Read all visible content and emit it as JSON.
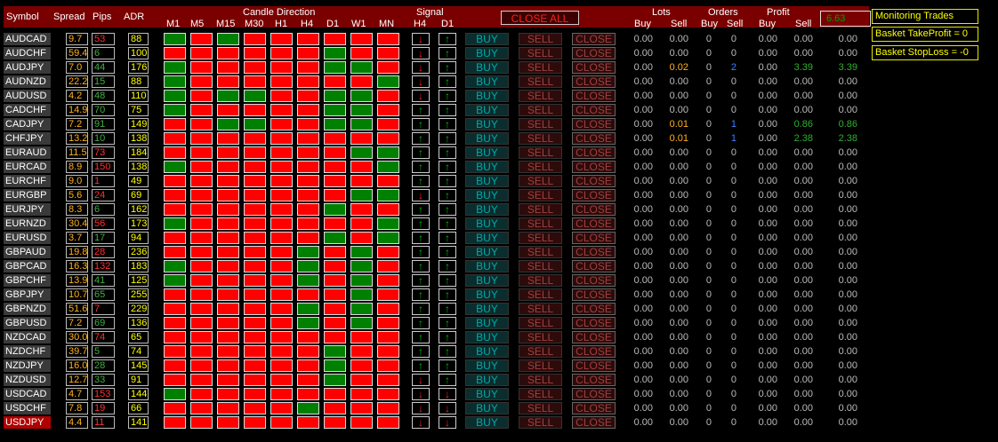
{
  "header": {
    "symbol": "Symbol",
    "spread": "Spread",
    "pips": "Pips",
    "adr": "ADR",
    "candle_direction": "Candle Direction",
    "timeframes": [
      "M1",
      "M5",
      "M15",
      "M30",
      "H1",
      "H4",
      "D1",
      "W1",
      "MN"
    ],
    "signal": "Signal",
    "signal_tfs": [
      "H4",
      "D1"
    ],
    "close_all": "CLOSE ALL",
    "lots": "Lots",
    "orders": "Orders",
    "profit": "Profit",
    "buy": "Buy",
    "sell": "Sell",
    "total_profit": "6.63"
  },
  "side_panel": {
    "monitoring": "Monitoring Trades",
    "basket_tp": "Basket TakeProfit = 0",
    "basket_sl": "Basket StopLoss = -0"
  },
  "buttons": {
    "buy": "BUY",
    "sell": "SELL",
    "close": "CLOSE"
  },
  "colors": {
    "red": "#ff0000",
    "green": "#008000",
    "header": "#7a0000",
    "selected_symbol": "#b00000"
  },
  "rows": [
    {
      "symbol": "AUDCAD",
      "spread": "9.7",
      "pips": "53",
      "pips_color": "#ff3030",
      "adr": "88",
      "candles": "GRGRRRRRR",
      "h4": "down",
      "d1": "up",
      "lots_buy": "0.00",
      "lots_sell": "0.00",
      "orders_buy": "0",
      "orders_sell": "0",
      "profit_buy": "0.00",
      "profit_sell": "0.00",
      "total": "0.00"
    },
    {
      "symbol": "AUDCHF",
      "spread": "59.4",
      "pips": "6",
      "pips_color": "#40b040",
      "adr": "100",
      "candles": "RRRRRRGRR",
      "h4": "down",
      "d1": "up",
      "lots_buy": "0.00",
      "lots_sell": "0.00",
      "orders_buy": "0",
      "orders_sell": "0",
      "profit_buy": "0.00",
      "profit_sell": "0.00",
      "total": "0.00"
    },
    {
      "symbol": "AUDJPY",
      "spread": "7.0",
      "pips": "44",
      "pips_color": "#40b040",
      "adr": "176",
      "candles": "GRRRRRGGR",
      "h4": "down",
      "d1": "up",
      "lots_buy": "0.00",
      "lots_sell": "0.02",
      "orders_buy": "0",
      "orders_sell": "2",
      "profit_buy": "0.00",
      "profit_sell": "3.39",
      "total": "3.39"
    },
    {
      "symbol": "AUDNZD",
      "spread": "22.2",
      "pips": "15",
      "pips_color": "#40b040",
      "adr": "88",
      "candles": "GRRRRRRRG",
      "h4": "down",
      "d1": "up",
      "lots_buy": "0.00",
      "lots_sell": "0.00",
      "orders_buy": "0",
      "orders_sell": "0",
      "profit_buy": "0.00",
      "profit_sell": "0.00",
      "total": "0.00"
    },
    {
      "symbol": "AUDUSD",
      "spread": "4.2",
      "pips": "48",
      "pips_color": "#40b040",
      "adr": "110",
      "candles": "GRGGRRGGR",
      "h4": "down",
      "d1": "up",
      "lots_buy": "0.00",
      "lots_sell": "0.00",
      "orders_buy": "0",
      "orders_sell": "0",
      "profit_buy": "0.00",
      "profit_sell": "0.00",
      "total": "0.00"
    },
    {
      "symbol": "CADCHF",
      "spread": "14.9",
      "pips": "70",
      "pips_color": "#40b040",
      "adr": "75",
      "candles": "GRRRRRGGR",
      "h4": "up",
      "d1": "up",
      "lots_buy": "0.00",
      "lots_sell": "0.00",
      "orders_buy": "0",
      "orders_sell": "0",
      "profit_buy": "0.00",
      "profit_sell": "0.00",
      "total": "0.00"
    },
    {
      "symbol": "CADJPY",
      "spread": "7.2",
      "pips": "91",
      "pips_color": "#40b040",
      "adr": "149",
      "candles": "RRGGRRGGR",
      "h4": "up",
      "d1": "up",
      "lots_buy": "0.00",
      "lots_sell": "0.01",
      "orders_buy": "0",
      "orders_sell": "1",
      "profit_buy": "0.00",
      "profit_sell": "0.86",
      "total": "0.86"
    },
    {
      "symbol": "CHFJPY",
      "spread": "13.2",
      "pips": "10",
      "pips_color": "#40b040",
      "adr": "138",
      "candles": "RRRRRRRRR",
      "h4": "up",
      "d1": "up",
      "lots_buy": "0.00",
      "lots_sell": "0.01",
      "orders_buy": "0",
      "orders_sell": "1",
      "profit_buy": "0.00",
      "profit_sell": "2.38",
      "total": "2.38"
    },
    {
      "symbol": "EURAUD",
      "spread": "11.5",
      "pips": "73",
      "pips_color": "#ff3030",
      "adr": "184",
      "candles": "RRRRRRRGG",
      "h4": "up",
      "d1": "up",
      "lots_buy": "0.00",
      "lots_sell": "0.00",
      "orders_buy": "0",
      "orders_sell": "0",
      "profit_buy": "0.00",
      "profit_sell": "0.00",
      "total": "0.00"
    },
    {
      "symbol": "EURCAD",
      "spread": "8.9",
      "pips": "150",
      "pips_color": "#ff3030",
      "adr": "138",
      "candles": "GRRRRRRRG",
      "h4": "up",
      "d1": "up",
      "lots_buy": "0.00",
      "lots_sell": "0.00",
      "orders_buy": "0",
      "orders_sell": "0",
      "profit_buy": "0.00",
      "profit_sell": "0.00",
      "total": "0.00"
    },
    {
      "symbol": "EURCHF",
      "spread": "9.0",
      "pips": "1",
      "pips_color": "#ff3030",
      "adr": "49",
      "candles": "RRRRRRRRR",
      "h4": "up",
      "d1": "up",
      "lots_buy": "0.00",
      "lots_sell": "0.00",
      "orders_buy": "0",
      "orders_sell": "0",
      "profit_buy": "0.00",
      "profit_sell": "0.00",
      "total": "0.00"
    },
    {
      "symbol": "EURGBP",
      "spread": "5.6",
      "pips": "24",
      "pips_color": "#ff3030",
      "adr": "69",
      "candles": "RRRRRRRGG",
      "h4": "down",
      "d1": "up",
      "lots_buy": "0.00",
      "lots_sell": "0.00",
      "orders_buy": "0",
      "orders_sell": "0",
      "profit_buy": "0.00",
      "profit_sell": "0.00",
      "total": "0.00"
    },
    {
      "symbol": "EURJPY",
      "spread": "8.3",
      "pips": "6",
      "pips_color": "#40b040",
      "adr": "162",
      "candles": "RRRRRRGRR",
      "h4": "up",
      "d1": "up",
      "lots_buy": "0.00",
      "lots_sell": "0.00",
      "orders_buy": "0",
      "orders_sell": "0",
      "profit_buy": "0.00",
      "profit_sell": "0.00",
      "total": "0.00"
    },
    {
      "symbol": "EURNZD",
      "spread": "30.4",
      "pips": "56",
      "pips_color": "#ff3030",
      "adr": "173",
      "candles": "GRRRRRRRG",
      "h4": "up",
      "d1": "up",
      "lots_buy": "0.00",
      "lots_sell": "0.00",
      "orders_buy": "0",
      "orders_sell": "0",
      "profit_buy": "0.00",
      "profit_sell": "0.00",
      "total": "0.00"
    },
    {
      "symbol": "EURUSD",
      "spread": "3.7",
      "pips": "17",
      "pips_color": "#40b040",
      "adr": "94",
      "candles": "RRRRRRGRG",
      "h4": "up",
      "d1": "up",
      "lots_buy": "0.00",
      "lots_sell": "0.00",
      "orders_buy": "0",
      "orders_sell": "0",
      "profit_buy": "0.00",
      "profit_sell": "0.00",
      "total": "0.00"
    },
    {
      "symbol": "GBPAUD",
      "spread": "19.8",
      "pips": "28",
      "pips_color": "#ff3030",
      "adr": "236",
      "candles": "RRRRRGRGR",
      "h4": "up",
      "d1": "up",
      "lots_buy": "0.00",
      "lots_sell": "0.00",
      "orders_buy": "0",
      "orders_sell": "0",
      "profit_buy": "0.00",
      "profit_sell": "0.00",
      "total": "0.00"
    },
    {
      "symbol": "GBPCAD",
      "spread": "16.3",
      "pips": "132",
      "pips_color": "#ff3030",
      "adr": "183",
      "candles": "GRRRRGRGR",
      "h4": "up",
      "d1": "up",
      "lots_buy": "0.00",
      "lots_sell": "0.00",
      "orders_buy": "0",
      "orders_sell": "0",
      "profit_buy": "0.00",
      "profit_sell": "0.00",
      "total": "0.00"
    },
    {
      "symbol": "GBPCHF",
      "spread": "13.9",
      "pips": "41",
      "pips_color": "#40b040",
      "adr": "125",
      "candles": "GRRRRGRGR",
      "h4": "up",
      "d1": "up",
      "lots_buy": "0.00",
      "lots_sell": "0.00",
      "orders_buy": "0",
      "orders_sell": "0",
      "profit_buy": "0.00",
      "profit_sell": "0.00",
      "total": "0.00"
    },
    {
      "symbol": "GBPJPY",
      "spread": "10.7",
      "pips": "65",
      "pips_color": "#40b040",
      "adr": "255",
      "candles": "RRRRRRRGR",
      "h4": "up",
      "d1": "up",
      "lots_buy": "0.00",
      "lots_sell": "0.00",
      "orders_buy": "0",
      "orders_sell": "0",
      "profit_buy": "0.00",
      "profit_sell": "0.00",
      "total": "0.00"
    },
    {
      "symbol": "GBPNZD",
      "spread": "51.6",
      "pips": "7",
      "pips_color": "#ff3030",
      "adr": "229",
      "candles": "RRRRRGRGR",
      "h4": "up",
      "d1": "up",
      "lots_buy": "0.00",
      "lots_sell": "0.00",
      "orders_buy": "0",
      "orders_sell": "0",
      "profit_buy": "0.00",
      "profit_sell": "0.00",
      "total": "0.00"
    },
    {
      "symbol": "GBPUSD",
      "spread": "7.2",
      "pips": "69",
      "pips_color": "#40b040",
      "adr": "136",
      "candles": "RRRRRGRGR",
      "h4": "up",
      "d1": "up",
      "lots_buy": "0.00",
      "lots_sell": "0.00",
      "orders_buy": "0",
      "orders_sell": "0",
      "profit_buy": "0.00",
      "profit_sell": "0.00",
      "total": "0.00"
    },
    {
      "symbol": "NZDCAD",
      "spread": "30.0",
      "pips": "74",
      "pips_color": "#ff3030",
      "adr": "65",
      "candles": "RRRRRRRRR",
      "h4": "up",
      "d1": "up",
      "lots_buy": "0.00",
      "lots_sell": "0.00",
      "orders_buy": "0",
      "orders_sell": "0",
      "profit_buy": "0.00",
      "profit_sell": "0.00",
      "total": "0.00"
    },
    {
      "symbol": "NZDCHF",
      "spread": "39.7",
      "pips": "5",
      "pips_color": "#40b040",
      "adr": "74",
      "candles": "RRRRRRGRR",
      "h4": "up",
      "d1": "up",
      "lots_buy": "0.00",
      "lots_sell": "0.00",
      "orders_buy": "0",
      "orders_sell": "0",
      "profit_buy": "0.00",
      "profit_sell": "0.00",
      "total": "0.00"
    },
    {
      "symbol": "NZDJPY",
      "spread": "16.0",
      "pips": "28",
      "pips_color": "#40b040",
      "adr": "145",
      "candles": "RRRRRRGRR",
      "h4": "up",
      "d1": "up",
      "lots_buy": "0.00",
      "lots_sell": "0.00",
      "orders_buy": "0",
      "orders_sell": "0",
      "profit_buy": "0.00",
      "profit_sell": "0.00",
      "total": "0.00"
    },
    {
      "symbol": "NZDUSD",
      "spread": "12.7",
      "pips": "33",
      "pips_color": "#40b040",
      "adr": "91",
      "candles": "RRRRRRGRR",
      "h4": "down",
      "d1": "up",
      "lots_buy": "0.00",
      "lots_sell": "0.00",
      "orders_buy": "0",
      "orders_sell": "0",
      "profit_buy": "0.00",
      "profit_sell": "0.00",
      "total": "0.00"
    },
    {
      "symbol": "USDCAD",
      "spread": "4.7",
      "pips": "153",
      "pips_color": "#ff3030",
      "adr": "144",
      "candles": "GRRRRRRRR",
      "h4": "down",
      "d1": "down",
      "lots_buy": "0.00",
      "lots_sell": "0.00",
      "orders_buy": "0",
      "orders_sell": "0",
      "profit_buy": "0.00",
      "profit_sell": "0.00",
      "total": "0.00"
    },
    {
      "symbol": "USDCHF",
      "spread": "7.8",
      "pips": "19",
      "pips_color": "#ff3030",
      "adr": "66",
      "candles": "RRRRRGRRR",
      "h4": "down",
      "d1": "down",
      "lots_buy": "0.00",
      "lots_sell": "0.00",
      "orders_buy": "0",
      "orders_sell": "0",
      "profit_buy": "0.00",
      "profit_sell": "0.00",
      "total": "0.00"
    },
    {
      "symbol": "USDJPY",
      "spread": "4.4",
      "pips": "11",
      "pips_color": "#ff3030",
      "adr": "141",
      "candles": "RRRRRRRRR",
      "h4": "down",
      "d1": "down",
      "lots_buy": "0.00",
      "lots_sell": "0.00",
      "orders_buy": "0",
      "orders_sell": "0",
      "profit_buy": "0.00",
      "profit_sell": "0.00",
      "total": "0.00",
      "selected": true
    }
  ]
}
